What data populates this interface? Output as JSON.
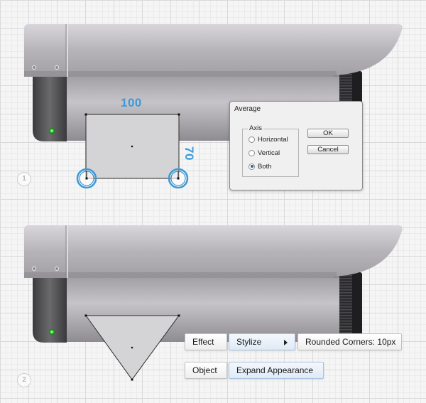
{
  "step_labels": [
    "1",
    "2"
  ],
  "dimensions": {
    "width_label": "100",
    "height_label": "70"
  },
  "average_dialog": {
    "title": "Average",
    "group_label": "Axis",
    "options": [
      {
        "label": "Horizontal",
        "checked": false
      },
      {
        "label": "Vertical",
        "checked": false
      },
      {
        "label": "Both",
        "checked": true
      }
    ],
    "ok_label": "OK",
    "cancel_label": "Cancel"
  },
  "menu_path_1": {
    "root": "Effect",
    "submenu": "Stylize",
    "item": "Rounded Corners: 10px"
  },
  "menu_path_2": {
    "root": "Object",
    "item": "Expand Appearance"
  },
  "colors": {
    "selection_blue": "#3d9ad9",
    "led_green": "#33dd33",
    "camera_body": "#b8b5ba"
  }
}
